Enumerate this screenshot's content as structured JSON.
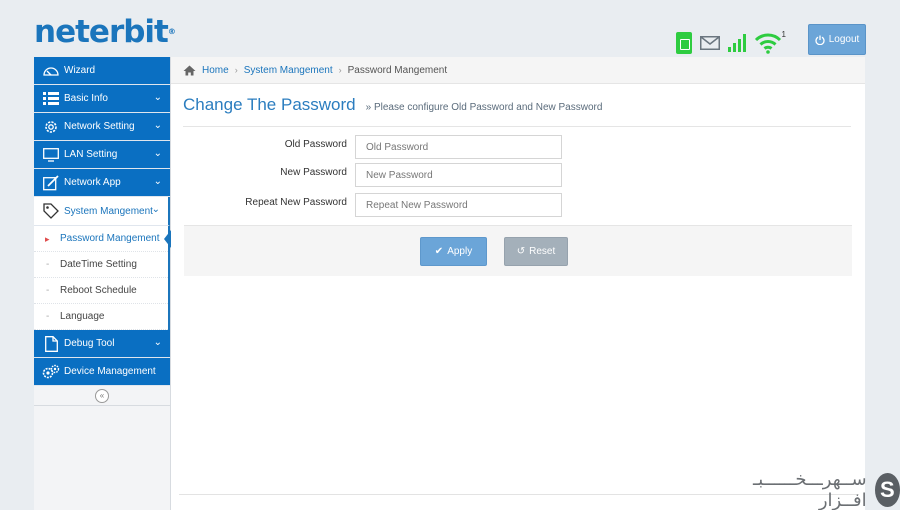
{
  "brand": {
    "logo_text": "neterbit",
    "logo_mark": "®"
  },
  "header": {
    "wifi_count": "1",
    "logout_label": "Logout",
    "accent_color": "#0a6fc2",
    "status_color": "#2ecc40"
  },
  "sidebar": {
    "items": [
      {
        "label": "Wizard",
        "icon": "speedometer-icon"
      },
      {
        "label": "Basic Info",
        "icon": "list-icon"
      },
      {
        "label": "Network Setting",
        "icon": "gear-icon"
      },
      {
        "label": "LAN Setting",
        "icon": "monitor-icon"
      },
      {
        "label": "Network App",
        "icon": "edit-icon"
      },
      {
        "label": "System Mangement",
        "icon": "tag-icon"
      },
      {
        "label": "Debug Tool",
        "icon": "file-icon"
      },
      {
        "label": "Device Management",
        "icon": "gears-icon"
      }
    ],
    "submenu": [
      {
        "label": "Password Mangement"
      },
      {
        "label": "DateTime Setting"
      },
      {
        "label": "Reboot Schedule"
      },
      {
        "label": "Language"
      }
    ],
    "collapse_glyph": "«"
  },
  "breadcrumb": {
    "home": "Home",
    "section": "System Mangement",
    "page": "Password Mangement"
  },
  "page": {
    "title": "Change The Password",
    "subtitle": "» Please configure Old Password and New Password"
  },
  "form": {
    "old_password": {
      "label": "Old Password",
      "placeholder": "Old Password"
    },
    "new_password": {
      "label": "New Password",
      "placeholder": "New Password"
    },
    "repeat_password": {
      "label": "Repeat New Password",
      "placeholder": "Repeat New Password"
    }
  },
  "actions": {
    "apply_label": "Apply",
    "reset_label": "Reset"
  },
  "watermark": {
    "text": "ســهرـــخــــــبـ افــزار",
    "logo_letter": "S"
  }
}
